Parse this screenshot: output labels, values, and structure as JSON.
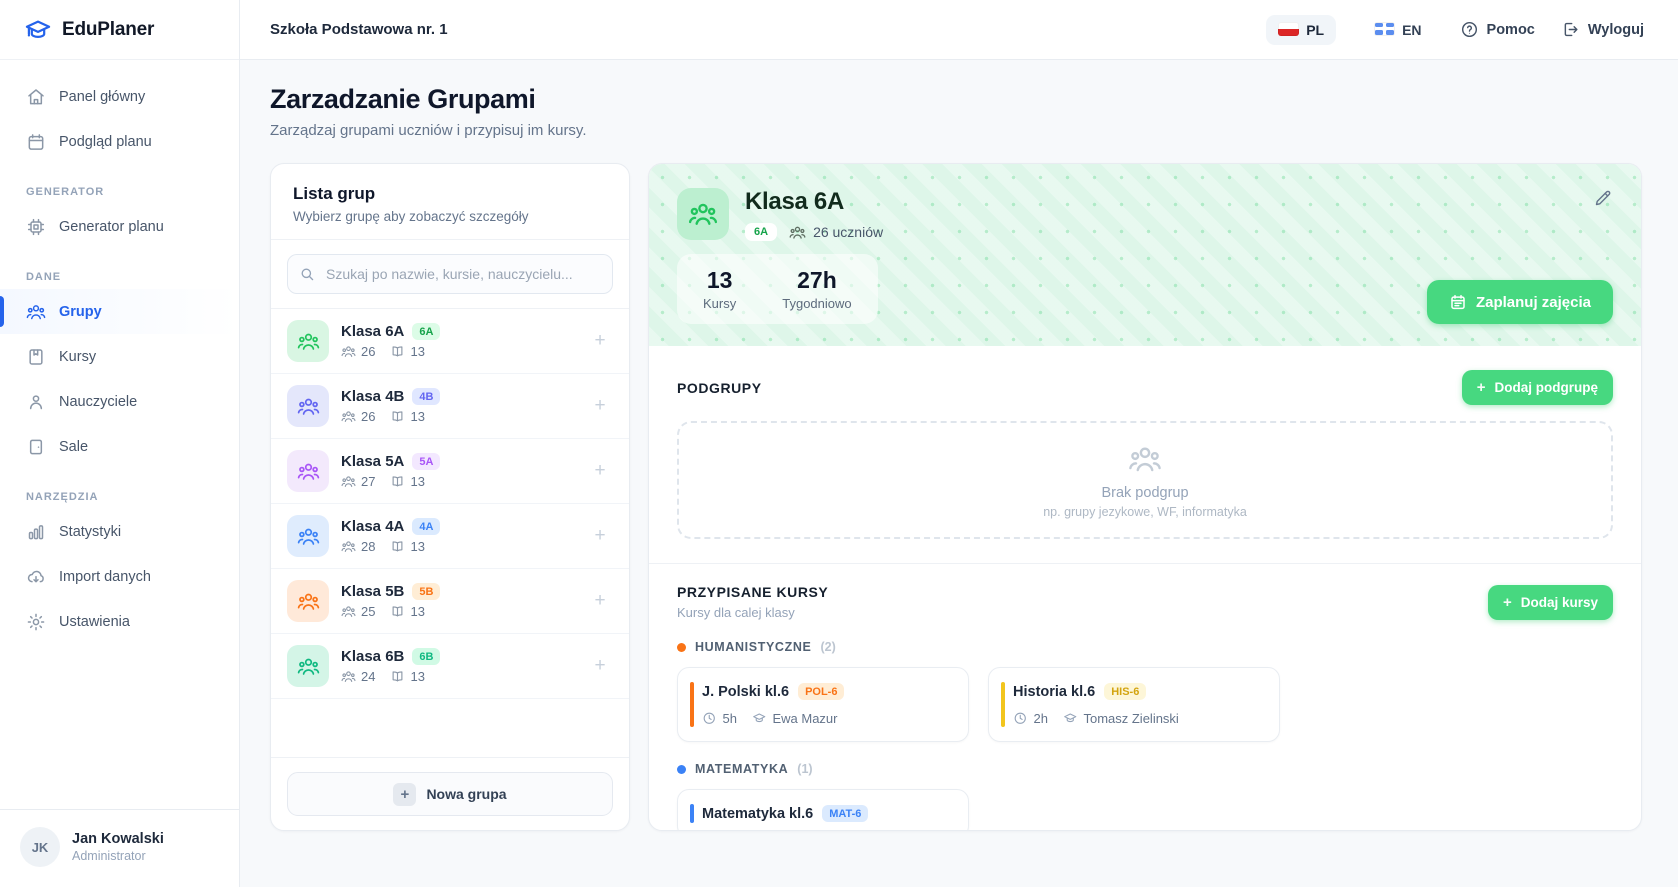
{
  "app": {
    "name": "EduPlaner"
  },
  "topbar": {
    "school": "Szkoła Podstawowa nr. 1",
    "lang_pl": "PL",
    "lang_en": "EN",
    "help": "Pomoc",
    "logout": "Wyloguj"
  },
  "sidebar": {
    "sections": [
      {
        "label": "",
        "items": [
          {
            "label": "Panel główny",
            "icon": "home-icon",
            "active": false
          },
          {
            "label": "Podgląd planu",
            "icon": "calendar-icon",
            "active": false
          }
        ]
      },
      {
        "label": "GENERATOR",
        "items": [
          {
            "label": "Generator planu",
            "icon": "cpu-icon",
            "active": false
          }
        ]
      },
      {
        "label": "DANE",
        "items": [
          {
            "label": "Grupy",
            "icon": "users-icon",
            "active": true
          },
          {
            "label": "Kursy",
            "icon": "book-icon",
            "active": false
          },
          {
            "label": "Nauczyciele",
            "icon": "person-icon",
            "active": false
          },
          {
            "label": "Sale",
            "icon": "door-icon",
            "active": false
          }
        ]
      },
      {
        "label": "NARZĘDZIA",
        "items": [
          {
            "label": "Statystyki",
            "icon": "bar-chart-icon",
            "active": false
          },
          {
            "label": "Import danych",
            "icon": "cloud-download-icon",
            "active": false
          },
          {
            "label": "Ustawienia",
            "icon": "gear-icon",
            "active": false
          }
        ]
      }
    ],
    "user": {
      "initials": "JK",
      "name": "Jan Kowalski",
      "role": "Administrator"
    }
  },
  "page": {
    "title": "Zarzadzanie Grupami",
    "subtitle": "Zarządzaj grupami uczniów i przypisuj im kursy."
  },
  "group_list": {
    "title": "Lista grup",
    "subtitle": "Wybierz grupę aby zobaczyć szczegóły",
    "search_placeholder": "Szukaj po nazwie, kursie, nauczycielu...",
    "groups": [
      {
        "name": "Klasa 6A",
        "badge": "6A",
        "students": "26",
        "courses": "13",
        "color": "green"
      },
      {
        "name": "Klasa 4B",
        "badge": "4B",
        "students": "26",
        "courses": "13",
        "color": "indigo"
      },
      {
        "name": "Klasa 5A",
        "badge": "5A",
        "students": "27",
        "courses": "13",
        "color": "purple"
      },
      {
        "name": "Klasa 4A",
        "badge": "4A",
        "students": "28",
        "courses": "13",
        "color": "blue"
      },
      {
        "name": "Klasa 5B",
        "badge": "5B",
        "students": "25",
        "courses": "13",
        "color": "orange"
      },
      {
        "name": "Klasa 6B",
        "badge": "6B",
        "students": "24",
        "courses": "13",
        "color": "emerald"
      }
    ],
    "new_group_label": "Nowa grupa"
  },
  "colors": {
    "green": {
      "fg": "#21c45d",
      "bg": "#d9f6e3",
      "badge_fg": "#16a34a",
      "badge_bg": "#dcfce7"
    },
    "indigo": {
      "fg": "#6366f1",
      "bg": "#e4e7fb",
      "badge_fg": "#6366f1",
      "badge_bg": "#e0e7ff"
    },
    "purple": {
      "fg": "#a855f7",
      "bg": "#f3e9fc",
      "badge_fg": "#a855f7",
      "badge_bg": "#f3e8ff"
    },
    "blue": {
      "fg": "#3b82f6",
      "bg": "#dfecfd",
      "badge_fg": "#3b82f6",
      "badge_bg": "#dbeafe"
    },
    "orange": {
      "fg": "#f97316",
      "bg": "#ffe9d9",
      "badge_fg": "#f97316",
      "badge_bg": "#ffedd5"
    },
    "emerald": {
      "fg": "#10b981",
      "bg": "#d4f5e7",
      "badge_fg": "#10b981",
      "badge_bg": "#d1fae5"
    }
  },
  "detail": {
    "name": "Klasa 6A",
    "badge": "6A",
    "students_label": "26 uczniów",
    "stats": [
      {
        "value": "13",
        "label": "Kursy"
      },
      {
        "value": "27h",
        "label": "Tygodniowo"
      }
    ],
    "schedule_button": "Zaplanuj zajęcia",
    "subgroups": {
      "title": "PODGRUPY",
      "add_button": "Dodaj podgrupę",
      "empty_title": "Brak podgrup",
      "empty_hint": "np. grupy jezykowe, WF, informatyka"
    },
    "courses": {
      "title": "PRZYPISANE KURSY",
      "subtitle": "Kursy dla calej klasy",
      "add_button": "Dodaj kursy",
      "categories": [
        {
          "name": "HUMANISTYCZNE",
          "count": "(2)",
          "dot": "#f97316",
          "items": [
            {
              "title": "J. Polski kl.6",
              "code": "POL-6",
              "code_fg": "#f97316",
              "code_bg": "#ffedd5",
              "accent": "#f97316",
              "hours": "5h",
              "teacher": "Ewa Mazur"
            },
            {
              "title": "Historia kl.6",
              "code": "HIS-6",
              "code_fg": "#d3a410",
              "code_bg": "#fdf6d8",
              "accent": "#f2c51d",
              "hours": "2h",
              "teacher": "Tomasz Zielinski"
            }
          ]
        },
        {
          "name": "MATEMATYKA",
          "count": "(1)",
          "dot": "#3b82f6",
          "items": [
            {
              "title": "Matematyka kl.6",
              "code": "MAT-6",
              "code_fg": "#3b82f6",
              "code_bg": "#dbeafe",
              "accent": "#3b82f6",
              "hours": "",
              "teacher": ""
            }
          ]
        }
      ]
    }
  }
}
